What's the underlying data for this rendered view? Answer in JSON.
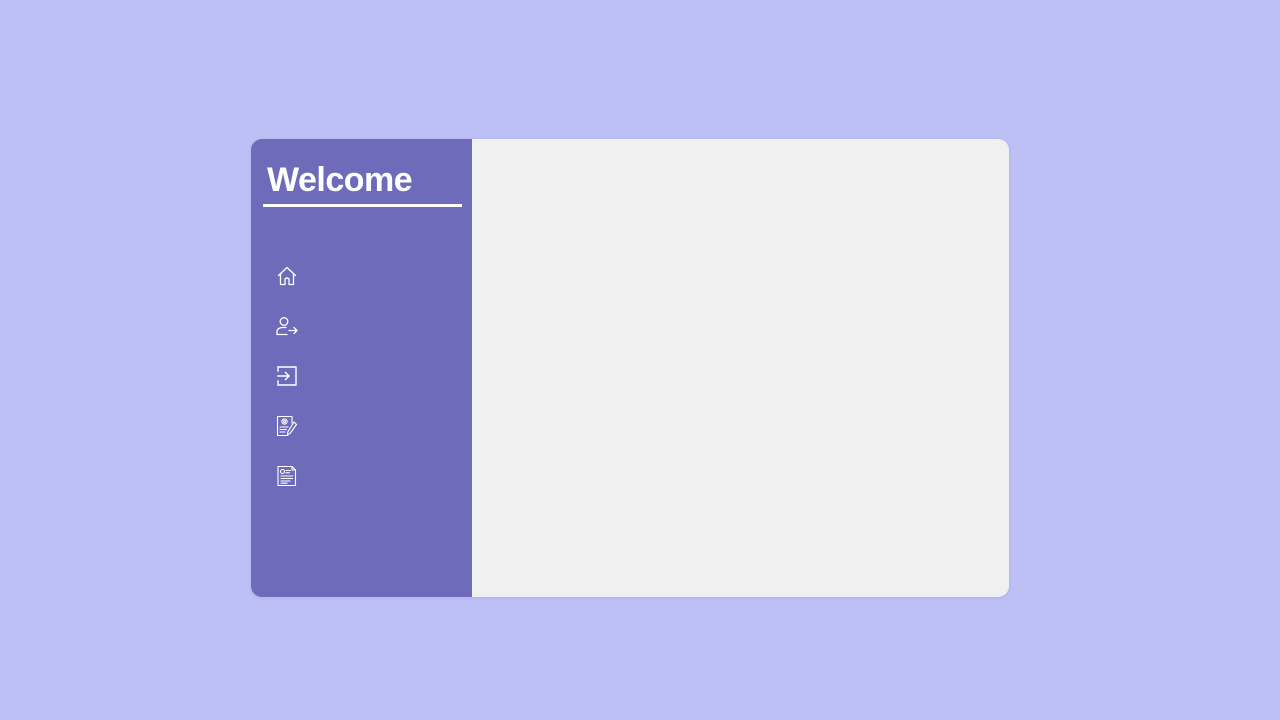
{
  "sidebar": {
    "title": "Welcome",
    "nav_items": [
      {
        "icon": "home-icon"
      },
      {
        "icon": "user-switch-icon"
      },
      {
        "icon": "login-icon"
      },
      {
        "icon": "edit-document-icon"
      },
      {
        "icon": "document-icon"
      }
    ]
  },
  "colors": {
    "page_background": "#bcc0f5",
    "sidebar_background": "#6e6bba",
    "content_background": "#f0f0f0",
    "sidebar_text": "#ffffff"
  }
}
